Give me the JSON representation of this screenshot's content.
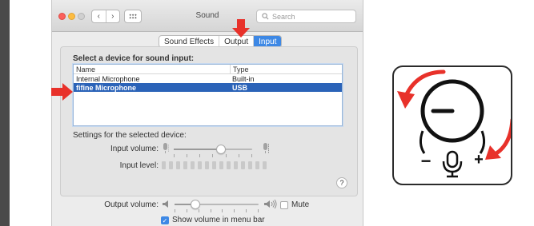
{
  "window": {
    "title": "Sound",
    "search_placeholder": "Search",
    "nav_back": "‹",
    "nav_forward": "›"
  },
  "tabs": [
    {
      "label": "Sound Effects",
      "active": false
    },
    {
      "label": "Output",
      "active": false
    },
    {
      "label": "Input",
      "active": true
    }
  ],
  "input": {
    "section_label": "Select a device for sound input:",
    "columns": {
      "name": "Name",
      "type": "Type"
    },
    "devices": [
      {
        "name": "Internal Microphone",
        "type": "Built-in",
        "selected": false
      },
      {
        "name": "fifine Microphone",
        "type": "USB",
        "selected": true
      }
    ],
    "settings_label": "Settings for the selected device:",
    "input_volume_label": "Input volume:",
    "input_volume_level": 0.6,
    "input_level_label": "Input level:",
    "input_level_segments": 15,
    "input_level_active": 0
  },
  "output": {
    "volume_label": "Output volume:",
    "volume_level": 0.25,
    "mute_label": "Mute",
    "mute_checked": false,
    "menu_bar_label": "Show volume in menu bar",
    "menu_bar_checked": true
  },
  "help_label": "?",
  "colors": {
    "accent": "#3d88e5",
    "selection": "#2b63b8",
    "annotation_arrow": "#e8312a"
  },
  "knob_illustration": {
    "minus_symbol": "−",
    "plus_symbol": "+",
    "icon": "microphone-icon"
  }
}
